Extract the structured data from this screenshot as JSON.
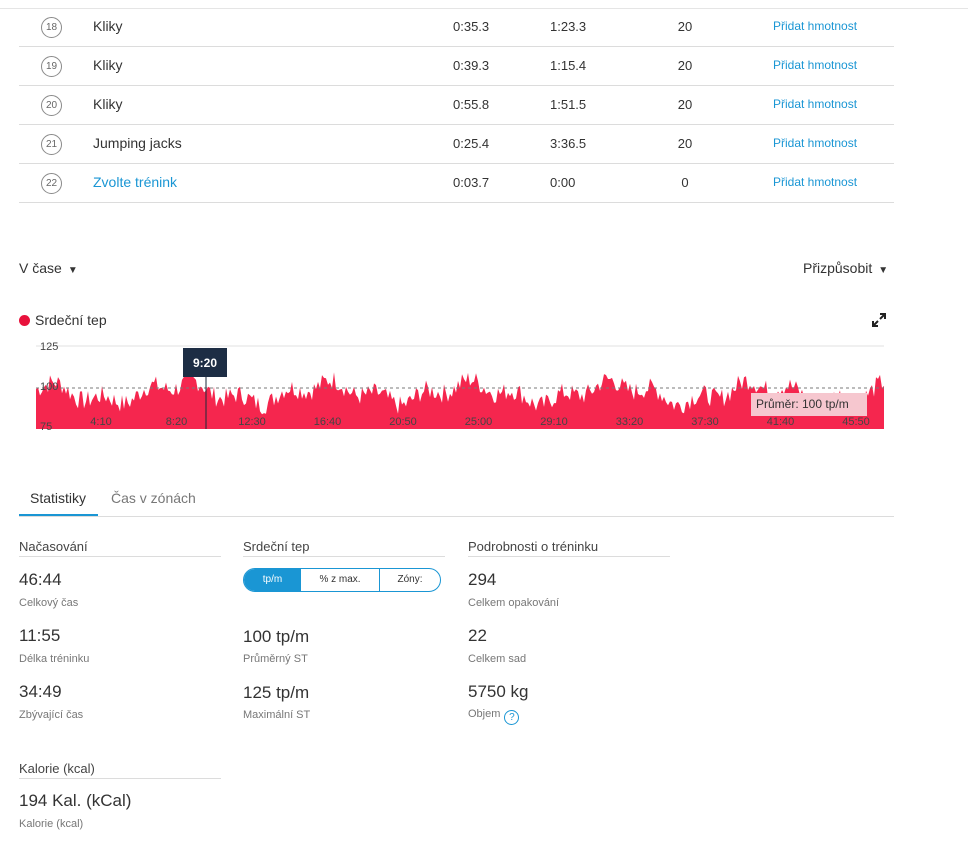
{
  "exercises": [
    {
      "num": "18",
      "name": "Kliky",
      "time": "0:35.3",
      "rest": "1:23.3",
      "reps": "20",
      "action": "Přidat hmotnost"
    },
    {
      "num": "19",
      "name": "Kliky",
      "time": "0:39.3",
      "rest": "1:15.4",
      "reps": "20",
      "action": "Přidat hmotnost"
    },
    {
      "num": "20",
      "name": "Kliky",
      "time": "0:55.8",
      "rest": "1:51.5",
      "reps": "20",
      "action": "Přidat hmotnost"
    },
    {
      "num": "21",
      "name": "Jumping jacks",
      "time": "0:25.4",
      "rest": "3:36.5",
      "reps": "20",
      "action": "Přidat hmotnost"
    },
    {
      "num": "22",
      "name": "Zvolte trénink",
      "time": "0:03.7",
      "rest": "0:00",
      "reps": "0",
      "action": "Přidat hmotnost"
    }
  ],
  "controls": {
    "time_dropdown": "V čase",
    "fit_dropdown": "Přizpůsobit"
  },
  "chart_data": {
    "type": "area",
    "series": [
      {
        "name": "Srdeční tep"
      }
    ],
    "yticks": [
      "125",
      "100",
      "75"
    ],
    "ylim": [
      75,
      125
    ],
    "xticks": [
      "4:10",
      "8:20",
      "12:30",
      "16:40",
      "20:50",
      "25:00",
      "29:10",
      "33:20",
      "37:30",
      "41:40",
      "45:50"
    ],
    "average_label": "Průměr: 100 tp/m",
    "cursor_label": "9:20",
    "average_value": 100,
    "color": "#f5264e"
  },
  "tabs": {
    "stats": "Statistiky",
    "zones": "Čas v zónách"
  },
  "timing": {
    "title": "Načasování",
    "total_value": "46:44",
    "total_label": "Celkový čas",
    "work_value": "11:55",
    "work_label": "Délka tréninku",
    "rest_value": "34:49",
    "rest_label": "Zbývající čas"
  },
  "heart": {
    "title": "Srdeční tep",
    "seg_bpm": "tp/m",
    "seg_pct": "% z max.",
    "seg_zones": "Zóny:",
    "avg_value": "100 tp/m",
    "avg_label": "Průměrný ST",
    "max_value": "125 tp/m",
    "max_label": "Maximální ST"
  },
  "details": {
    "title": "Podrobnosti o tréninku",
    "reps_value": "294",
    "reps_label": "Celkem opakování",
    "sets_value": "22",
    "sets_label": "Celkem sad",
    "volume_value": "5750 kg",
    "volume_label": "Objem",
    "help_icon": "?"
  },
  "calories": {
    "title": "Kalorie (kcal)",
    "value": "194 Kal. (kCal)",
    "label": "Kalorie (kcal)"
  }
}
